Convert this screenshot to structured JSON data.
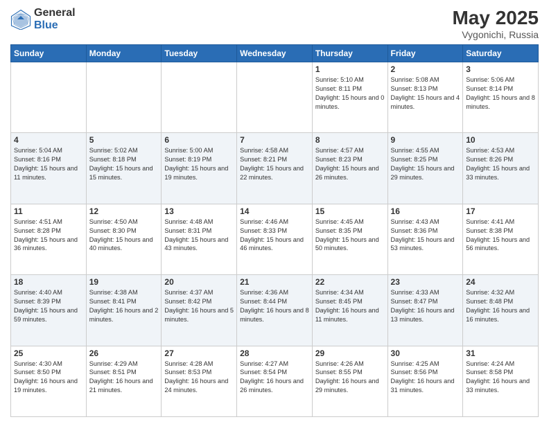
{
  "header": {
    "logo_general": "General",
    "logo_blue": "Blue",
    "month_year": "May 2025",
    "location": "Vygonichi, Russia"
  },
  "weekdays": [
    "Sunday",
    "Monday",
    "Tuesday",
    "Wednesday",
    "Thursday",
    "Friday",
    "Saturday"
  ],
  "weeks": [
    [
      {
        "day": "",
        "info": ""
      },
      {
        "day": "",
        "info": ""
      },
      {
        "day": "",
        "info": ""
      },
      {
        "day": "",
        "info": ""
      },
      {
        "day": "1",
        "info": "Sunrise: 5:10 AM\nSunset: 8:11 PM\nDaylight: 15 hours and 0 minutes."
      },
      {
        "day": "2",
        "info": "Sunrise: 5:08 AM\nSunset: 8:13 PM\nDaylight: 15 hours and 4 minutes."
      },
      {
        "day": "3",
        "info": "Sunrise: 5:06 AM\nSunset: 8:14 PM\nDaylight: 15 hours and 8 minutes."
      }
    ],
    [
      {
        "day": "4",
        "info": "Sunrise: 5:04 AM\nSunset: 8:16 PM\nDaylight: 15 hours and 11 minutes."
      },
      {
        "day": "5",
        "info": "Sunrise: 5:02 AM\nSunset: 8:18 PM\nDaylight: 15 hours and 15 minutes."
      },
      {
        "day": "6",
        "info": "Sunrise: 5:00 AM\nSunset: 8:19 PM\nDaylight: 15 hours and 19 minutes."
      },
      {
        "day": "7",
        "info": "Sunrise: 4:58 AM\nSunset: 8:21 PM\nDaylight: 15 hours and 22 minutes."
      },
      {
        "day": "8",
        "info": "Sunrise: 4:57 AM\nSunset: 8:23 PM\nDaylight: 15 hours and 26 minutes."
      },
      {
        "day": "9",
        "info": "Sunrise: 4:55 AM\nSunset: 8:25 PM\nDaylight: 15 hours and 29 minutes."
      },
      {
        "day": "10",
        "info": "Sunrise: 4:53 AM\nSunset: 8:26 PM\nDaylight: 15 hours and 33 minutes."
      }
    ],
    [
      {
        "day": "11",
        "info": "Sunrise: 4:51 AM\nSunset: 8:28 PM\nDaylight: 15 hours and 36 minutes."
      },
      {
        "day": "12",
        "info": "Sunrise: 4:50 AM\nSunset: 8:30 PM\nDaylight: 15 hours and 40 minutes."
      },
      {
        "day": "13",
        "info": "Sunrise: 4:48 AM\nSunset: 8:31 PM\nDaylight: 15 hours and 43 minutes."
      },
      {
        "day": "14",
        "info": "Sunrise: 4:46 AM\nSunset: 8:33 PM\nDaylight: 15 hours and 46 minutes."
      },
      {
        "day": "15",
        "info": "Sunrise: 4:45 AM\nSunset: 8:35 PM\nDaylight: 15 hours and 50 minutes."
      },
      {
        "day": "16",
        "info": "Sunrise: 4:43 AM\nSunset: 8:36 PM\nDaylight: 15 hours and 53 minutes."
      },
      {
        "day": "17",
        "info": "Sunrise: 4:41 AM\nSunset: 8:38 PM\nDaylight: 15 hours and 56 minutes."
      }
    ],
    [
      {
        "day": "18",
        "info": "Sunrise: 4:40 AM\nSunset: 8:39 PM\nDaylight: 15 hours and 59 minutes."
      },
      {
        "day": "19",
        "info": "Sunrise: 4:38 AM\nSunset: 8:41 PM\nDaylight: 16 hours and 2 minutes."
      },
      {
        "day": "20",
        "info": "Sunrise: 4:37 AM\nSunset: 8:42 PM\nDaylight: 16 hours and 5 minutes."
      },
      {
        "day": "21",
        "info": "Sunrise: 4:36 AM\nSunset: 8:44 PM\nDaylight: 16 hours and 8 minutes."
      },
      {
        "day": "22",
        "info": "Sunrise: 4:34 AM\nSunset: 8:45 PM\nDaylight: 16 hours and 11 minutes."
      },
      {
        "day": "23",
        "info": "Sunrise: 4:33 AM\nSunset: 8:47 PM\nDaylight: 16 hours and 13 minutes."
      },
      {
        "day": "24",
        "info": "Sunrise: 4:32 AM\nSunset: 8:48 PM\nDaylight: 16 hours and 16 minutes."
      }
    ],
    [
      {
        "day": "25",
        "info": "Sunrise: 4:30 AM\nSunset: 8:50 PM\nDaylight: 16 hours and 19 minutes."
      },
      {
        "day": "26",
        "info": "Sunrise: 4:29 AM\nSunset: 8:51 PM\nDaylight: 16 hours and 21 minutes."
      },
      {
        "day": "27",
        "info": "Sunrise: 4:28 AM\nSunset: 8:53 PM\nDaylight: 16 hours and 24 minutes."
      },
      {
        "day": "28",
        "info": "Sunrise: 4:27 AM\nSunset: 8:54 PM\nDaylight: 16 hours and 26 minutes."
      },
      {
        "day": "29",
        "info": "Sunrise: 4:26 AM\nSunset: 8:55 PM\nDaylight: 16 hours and 29 minutes."
      },
      {
        "day": "30",
        "info": "Sunrise: 4:25 AM\nSunset: 8:56 PM\nDaylight: 16 hours and 31 minutes."
      },
      {
        "day": "31",
        "info": "Sunrise: 4:24 AM\nSunset: 8:58 PM\nDaylight: 16 hours and 33 minutes."
      }
    ]
  ]
}
